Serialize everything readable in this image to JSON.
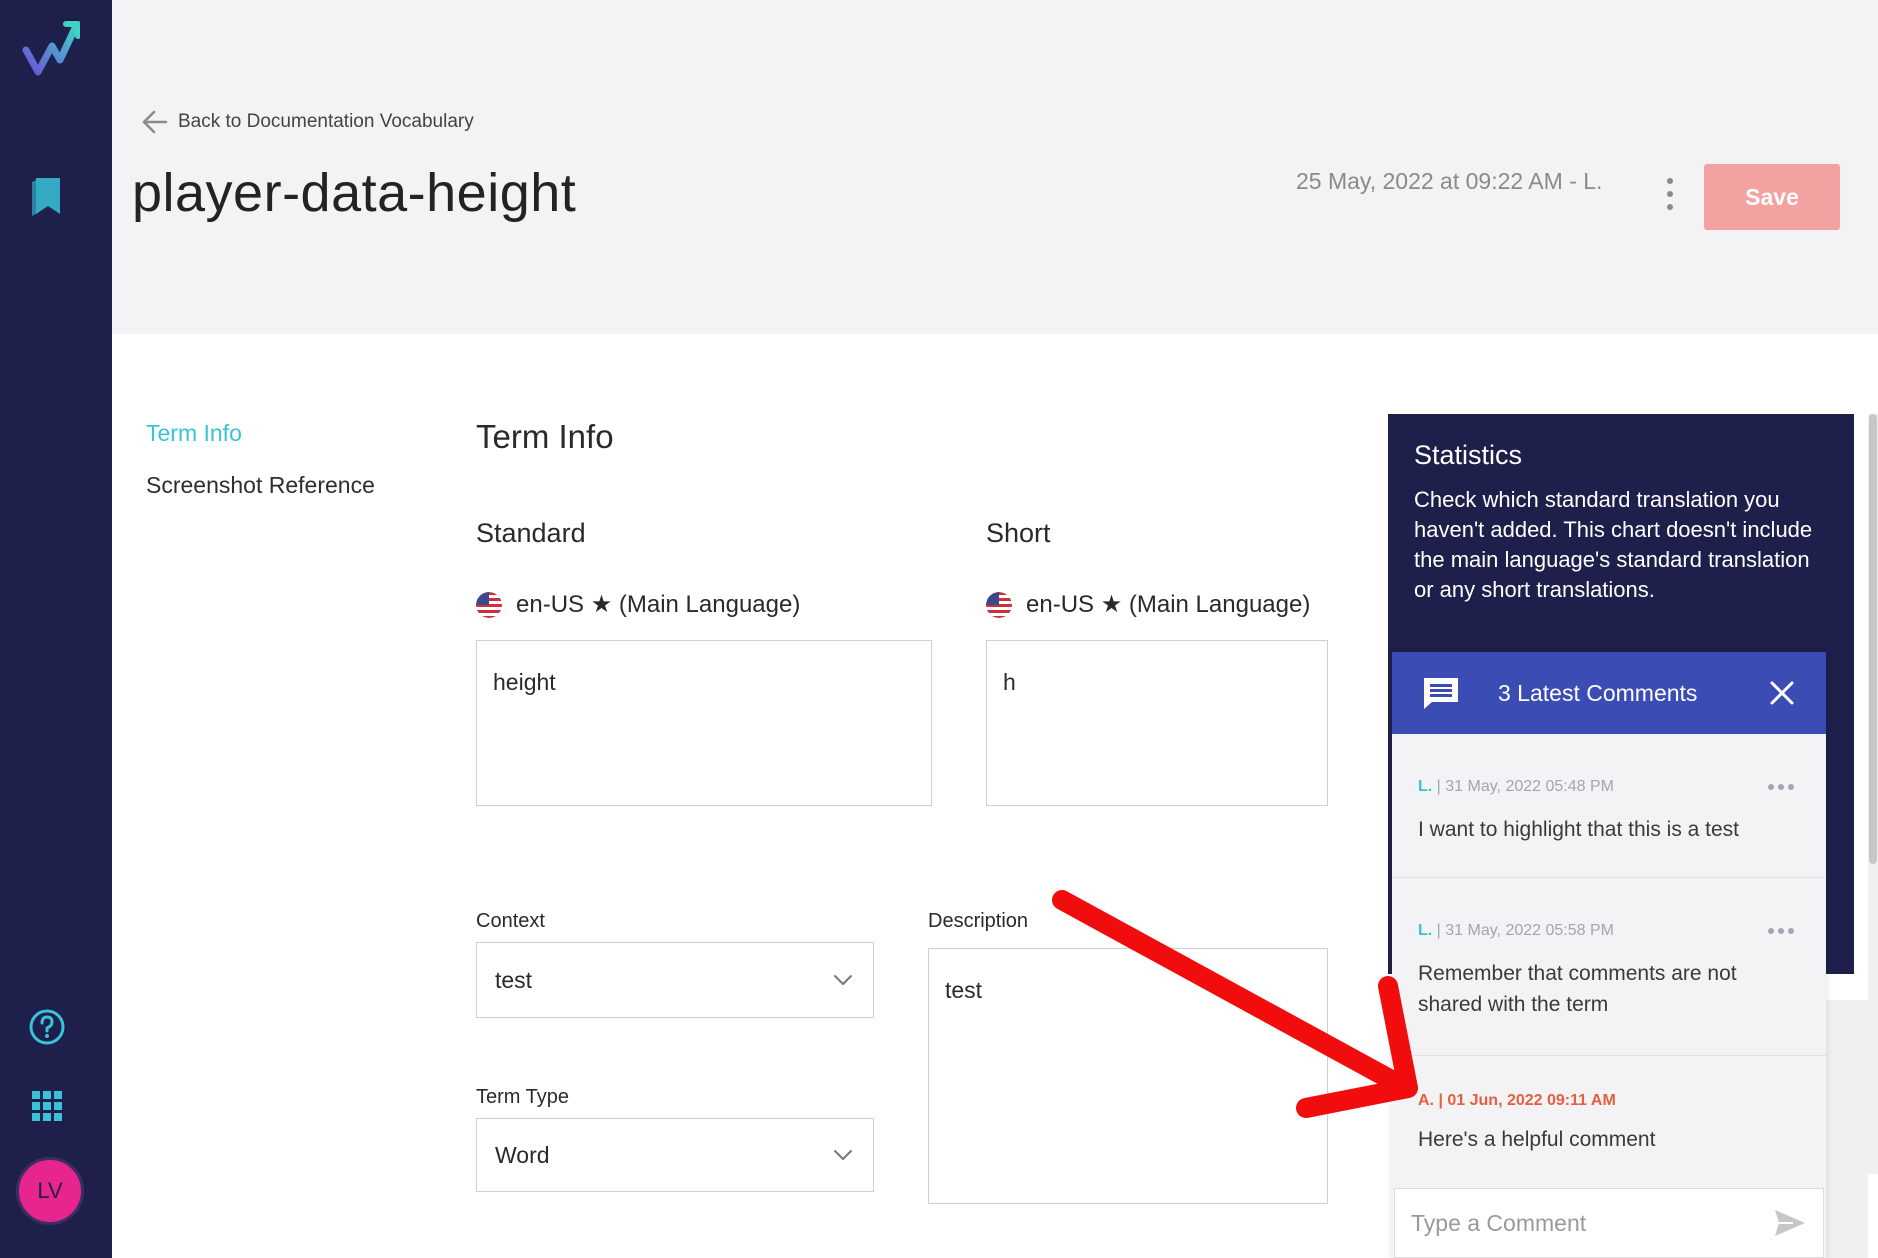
{
  "header": {
    "back_label": "Back to Documentation Vocabulary",
    "title": "player-data-height",
    "timestamp": "25 May, 2022 at 09:22 AM - L.",
    "save_label": "Save"
  },
  "sidebar": {
    "avatar_initials": "LV",
    "accent": "#38c3d9",
    "avatar_color": "#e8248f"
  },
  "anchor_nav": {
    "items": [
      "Term Info",
      "Screenshot Reference"
    ]
  },
  "form": {
    "section_title": "Term Info",
    "standard": {
      "label": "Standard",
      "language": "en-US ★ (Main Language)",
      "value": "height"
    },
    "short": {
      "label": "Short",
      "language": "en-US ★ (Main Language)",
      "value": "h"
    },
    "context": {
      "label": "Context",
      "value": "test"
    },
    "description": {
      "label": "Description",
      "value": "test"
    },
    "term_type": {
      "label": "Term Type",
      "value": "Word"
    }
  },
  "statistics": {
    "title": "Statistics",
    "text": "Check which standard translation you haven't added. This chart doesn't include the main language's standard translation or any short translations."
  },
  "comments": {
    "header": "3 Latest Comments",
    "items": [
      {
        "author": "L.",
        "time": "| 31 May, 2022 05:48 PM",
        "text": "I want to highlight that this is a test"
      },
      {
        "author": "L.",
        "time": "| 31 May, 2022 05:58 PM",
        "text": "Remember that comments are not shared with the term"
      },
      {
        "author": "A.",
        "time": "| 01 Jun, 2022 09:11 AM",
        "text": "Here's a helpful comment"
      }
    ],
    "input_placeholder": "Type a Comment",
    "header_color": "#3b4db5",
    "recent_color": "#e85d3f"
  }
}
